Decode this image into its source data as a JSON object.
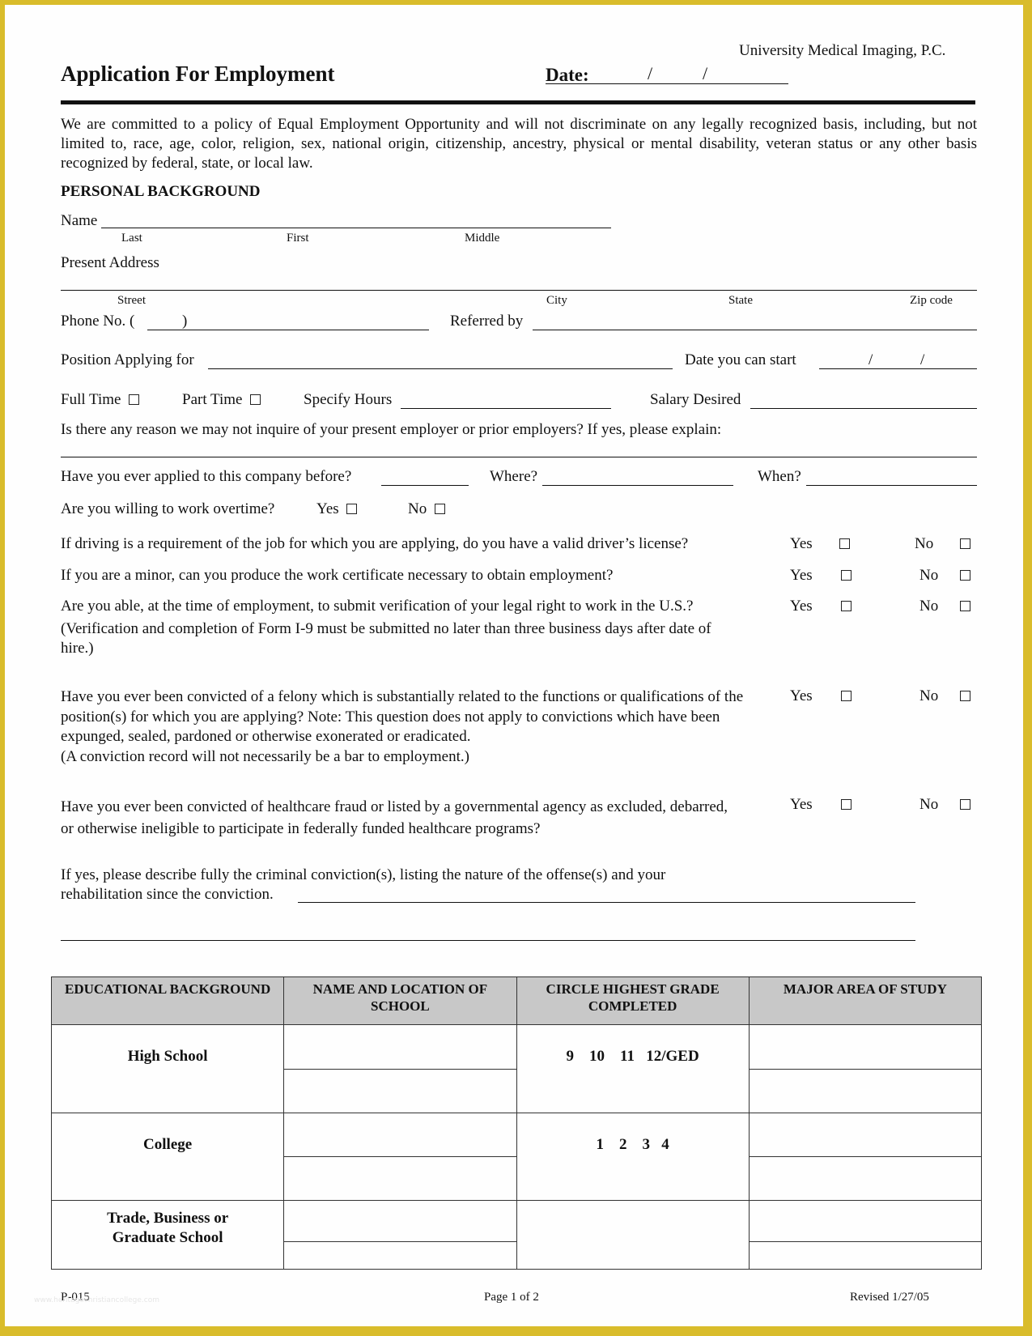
{
  "header": {
    "company": "University Medical Imaging, P.C.",
    "title": "Application For Employment",
    "date_label": "Date:",
    "date_sep1": "/",
    "date_sep2": "/"
  },
  "eeo_statement": "We are committed to a policy of Equal Employment Opportunity and will not discriminate on any legally recognized basis, including, but not limited to, race, age, color, religion, sex, national origin, citizenship, ancestry, physical or mental disability, veteran status or any other basis recognized by federal, state, or local law.",
  "personal": {
    "section_title": "PERSONAL BACKGROUND",
    "name_label": "Name",
    "name_sublabels": [
      "Last",
      "First",
      "Middle"
    ],
    "address_label": "Present Address",
    "address_sublabels": [
      "Street",
      "City",
      "State",
      "Zip code"
    ],
    "phone_label": "Phone No. (",
    "phone_paren_close": ")",
    "referred_label": "Referred by",
    "position_label": "Position Applying for",
    "start_label": "Date you can start",
    "start_sep1": "/",
    "start_sep2": "/",
    "full_time_label": "Full Time",
    "part_time_label": "Part Time",
    "hours_label": "Specify Hours",
    "salary_label": "Salary Desired",
    "inquire_question": "Is there any reason we may not inquire of your present employer or prior employers?  If yes, please explain:",
    "applied_before_label": "Have you ever applied to this company before?",
    "where_label": "Where?",
    "when_label": "When?",
    "overtime_label": "Are you willing to work overtime?",
    "yes_label": "Yes",
    "no_label": "No"
  },
  "questions": [
    {
      "text": "If driving is a requirement of the job for which you are applying, do you have a valid driver’s license?",
      "yes": "Yes",
      "no": "No"
    },
    {
      "text": "If you are a minor, can you produce the work certificate necessary to obtain employment?",
      "yes": "Yes",
      "no": "No"
    },
    {
      "text": "Are you able, at the time of employment, to submit verification of your legal right to work in the U.S.?",
      "note": "(Verification and completion of Form I-9 must be submitted no later than three business days after date of hire.)",
      "yes": "Yes",
      "no": "No"
    },
    {
      "text": "Have you ever been convicted of a felony which is substantially related to the functions or qualifications of the position(s) for which you are applying?  Note:  This question does not apply to convictions which have been expunged, sealed, pardoned or otherwise exonerated or eradicated.",
      "note": "(A conviction record will not necessarily be a bar to employment.)",
      "yes": "Yes",
      "no": "No"
    },
    {
      "text": "Have you ever been convicted of healthcare fraud or listed by a governmental agency as excluded, debarred, or otherwise ineligible to participate in federally funded healthcare programs?",
      "yes": "Yes",
      "no": "No"
    }
  ],
  "conviction_describe": {
    "line1": "If yes, please describe fully the criminal conviction(s), listing the nature of the offense(s) and your",
    "line2": "rehabilitation since the conviction."
  },
  "education_table": {
    "headers": [
      "EDUCATIONAL BACKGROUND",
      "NAME AND LOCATION OF SCHOOL",
      "CIRCLE HIGHEST GRADE COMPLETED",
      "MAJOR AREA OF STUDY"
    ],
    "rows": [
      {
        "label": "High School",
        "grades": "9    10    11   12/GED"
      },
      {
        "label": "College",
        "grades": "1    2    3   4"
      },
      {
        "label": "Trade, Business or Graduate School",
        "grades": ""
      }
    ]
  },
  "footer": {
    "form_id": "P-015",
    "page": "Page 1 of 2",
    "revised": "Revised 1/27/05",
    "watermark": "www.heritagechristiancollege.com"
  }
}
